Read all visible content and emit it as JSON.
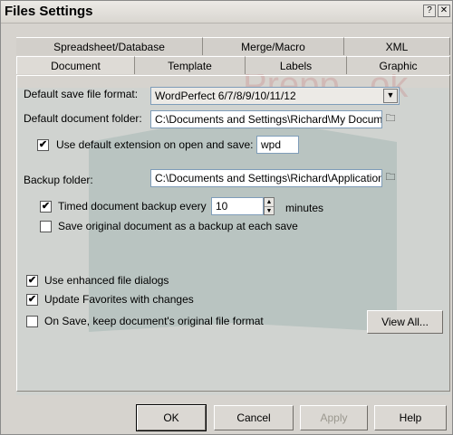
{
  "window": {
    "title": "Files Settings",
    "help_glyph": "?",
    "close_glyph": "✕"
  },
  "tabs_row1": [
    "Spreadsheet/Database",
    "Merge/Macro",
    "XML"
  ],
  "tabs_row2": [
    "Document",
    "Template",
    "Labels",
    "Graphic"
  ],
  "active_tab": "Document",
  "watermark_text": "Prepp...ok",
  "document": {
    "default_format_label": "Default save file format:",
    "default_format_value": "WordPerfect 6/7/8/9/10/11/12",
    "default_folder_label": "Default document folder:",
    "default_folder_value": "C:\\Documents and Settings\\Richard\\My Docum",
    "use_default_ext_label": "Use default extension on open and save:",
    "use_default_ext_checked": true,
    "extension_value": "wpd",
    "backup_folder_label": "Backup folder:",
    "backup_folder_value": "C:\\Documents and Settings\\Richard\\Application",
    "timed_backup_label": "Timed document backup every",
    "timed_backup_checked": true,
    "timed_backup_value": "10",
    "minutes_label": "minutes",
    "save_original_label": "Save original document as a backup at each save",
    "save_original_checked": false,
    "enhanced_dialogs_label": "Use enhanced file dialogs",
    "enhanced_dialogs_checked": true,
    "update_favorites_label": "Update Favorites with changes",
    "update_favorites_checked": true,
    "keep_format_label": "On Save, keep document's original file format",
    "keep_format_checked": false,
    "view_all_label": "View All..."
  },
  "buttons": {
    "ok": "OK",
    "cancel": "Cancel",
    "apply": "Apply",
    "help": "Help"
  },
  "icons": {
    "dropdown": "chevron-down-icon",
    "folder": "folder-icon",
    "check": "✔",
    "spin_up": "▲",
    "spin_down": "▼"
  }
}
